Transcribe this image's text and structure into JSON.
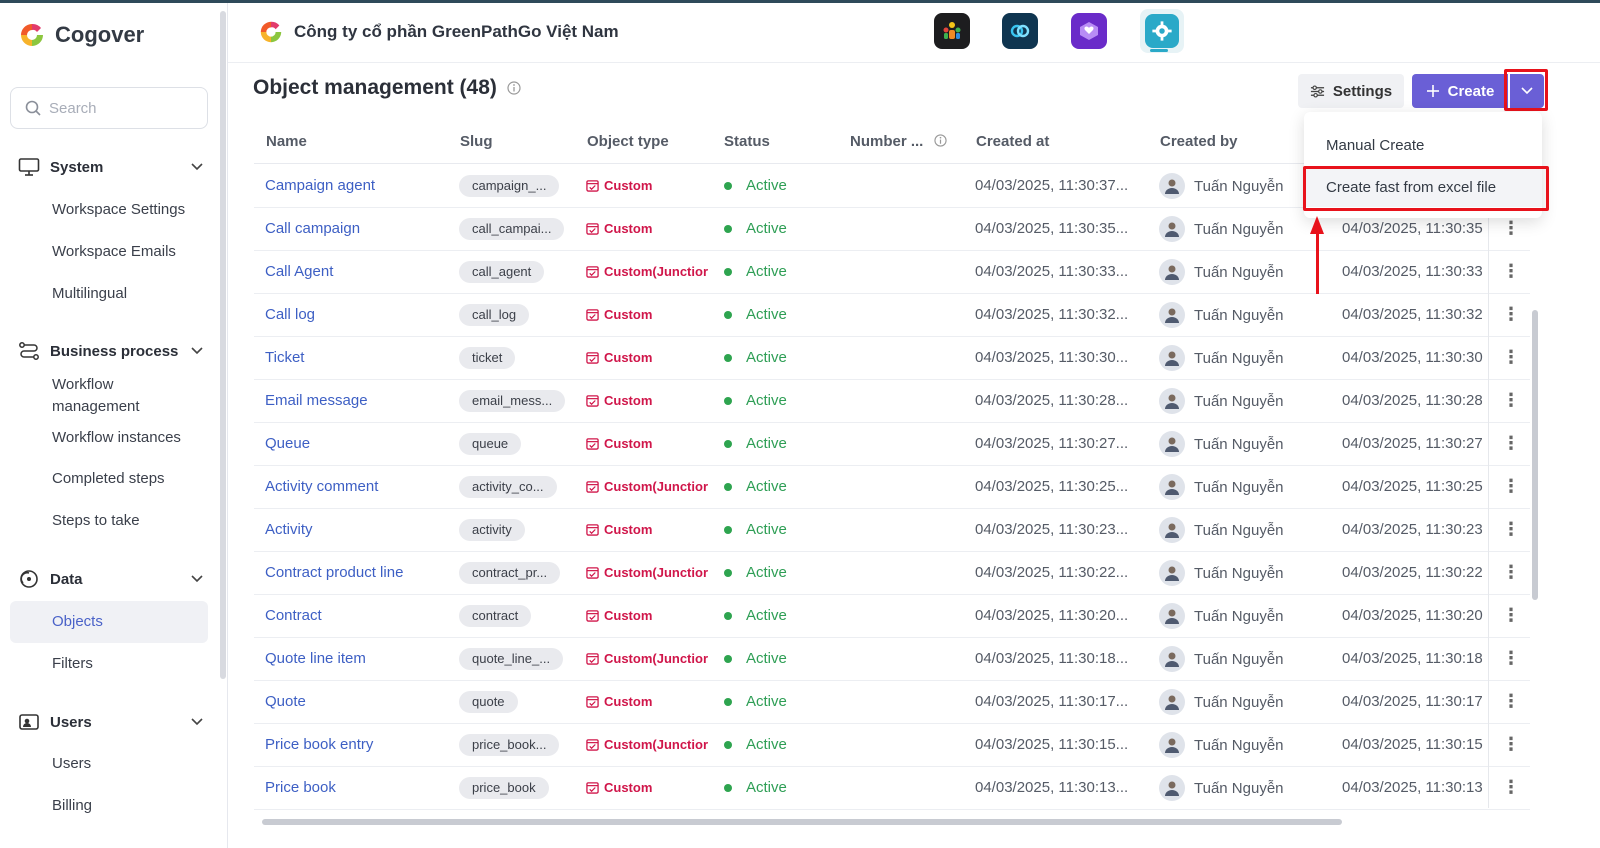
{
  "brand": {
    "name": "Cogover"
  },
  "search": {
    "placeholder": "Search"
  },
  "sidebar": {
    "groups": [
      {
        "label": "System",
        "items": [
          "Workspace Settings",
          "Workspace Emails",
          "Multilingual"
        ]
      },
      {
        "label": "Business process",
        "items": [
          "Workflow management",
          "Workflow instances",
          "Completed steps",
          "Steps to take"
        ]
      },
      {
        "label": "Data",
        "items": [
          "Objects",
          "Filters"
        ]
      },
      {
        "label": "Users",
        "items": [
          "Users",
          "Billing"
        ]
      }
    ],
    "active_item": "Objects"
  },
  "header": {
    "company": "Công ty cổ phần GreenPathGo Việt Nam",
    "apps": [
      "people-app-icon",
      "link-app-icon",
      "heart-box-app-icon",
      "gear-app-icon"
    ]
  },
  "page": {
    "title": "Object management (48)",
    "settings_label": "Settings",
    "create_label": "Create"
  },
  "menu": {
    "items": [
      "Manual Create",
      "Create fast from excel file"
    ]
  },
  "table": {
    "headers": [
      "Name",
      "Slug",
      "Object type",
      "Status",
      "Number ...",
      "Created at",
      "Created by"
    ],
    "rows": [
      {
        "name": "Campaign agent",
        "slug": "campaign_...",
        "type": "Custom",
        "status": "Active",
        "created": "04/03/2025, 11:30:37...",
        "by": "Tuấn Nguyễn",
        "updated": ""
      },
      {
        "name": "Call campaign",
        "slug": "call_campai...",
        "type": "Custom",
        "status": "Active",
        "created": "04/03/2025, 11:30:35...",
        "by": "Tuấn Nguyễn",
        "updated": "04/03/2025, 11:30:35"
      },
      {
        "name": "Call Agent",
        "slug": "call_agent",
        "type": "Custom(Junctior",
        "status": "Active",
        "created": "04/03/2025, 11:30:33...",
        "by": "Tuấn Nguyễn",
        "updated": "04/03/2025, 11:30:33"
      },
      {
        "name": "Call log",
        "slug": "call_log",
        "type": "Custom",
        "status": "Active",
        "created": "04/03/2025, 11:30:32...",
        "by": "Tuấn Nguyễn",
        "updated": "04/03/2025, 11:30:32"
      },
      {
        "name": "Ticket",
        "slug": "ticket",
        "type": "Custom",
        "status": "Active",
        "created": "04/03/2025, 11:30:30...",
        "by": "Tuấn Nguyễn",
        "updated": "04/03/2025, 11:30:30"
      },
      {
        "name": "Email message",
        "slug": "email_mess...",
        "type": "Custom",
        "status": "Active",
        "created": "04/03/2025, 11:30:28...",
        "by": "Tuấn Nguyễn",
        "updated": "04/03/2025, 11:30:28"
      },
      {
        "name": "Queue",
        "slug": "queue",
        "type": "Custom",
        "status": "Active",
        "created": "04/03/2025, 11:30:27...",
        "by": "Tuấn Nguyễn",
        "updated": "04/03/2025, 11:30:27"
      },
      {
        "name": "Activity comment",
        "slug": "activity_co...",
        "type": "Custom(Junctior",
        "status": "Active",
        "created": "04/03/2025, 11:30:25...",
        "by": "Tuấn Nguyễn",
        "updated": "04/03/2025, 11:30:25"
      },
      {
        "name": "Activity",
        "slug": "activity",
        "type": "Custom",
        "status": "Active",
        "created": "04/03/2025, 11:30:23...",
        "by": "Tuấn Nguyễn",
        "updated": "04/03/2025, 11:30:23"
      },
      {
        "name": "Contract product line",
        "slug": "contract_pr...",
        "type": "Custom(Junctior",
        "status": "Active",
        "created": "04/03/2025, 11:30:22...",
        "by": "Tuấn Nguyễn",
        "updated": "04/03/2025, 11:30:22"
      },
      {
        "name": "Contract",
        "slug": "contract",
        "type": "Custom",
        "status": "Active",
        "created": "04/03/2025, 11:30:20...",
        "by": "Tuấn Nguyễn",
        "updated": "04/03/2025, 11:30:20"
      },
      {
        "name": "Quote line item",
        "slug": "quote_line_...",
        "type": "Custom(Junctior",
        "status": "Active",
        "created": "04/03/2025, 11:30:18...",
        "by": "Tuấn Nguyễn",
        "updated": "04/03/2025, 11:30:18"
      },
      {
        "name": "Quote",
        "slug": "quote",
        "type": "Custom",
        "status": "Active",
        "created": "04/03/2025, 11:30:17...",
        "by": "Tuấn Nguyễn",
        "updated": "04/03/2025, 11:30:17"
      },
      {
        "name": "Price book entry",
        "slug": "price_book...",
        "type": "Custom(Junctior",
        "status": "Active",
        "created": "04/03/2025, 11:30:15...",
        "by": "Tuấn Nguyễn",
        "updated": "04/03/2025, 11:30:15"
      },
      {
        "name": "Price book",
        "slug": "price_book",
        "type": "Custom",
        "status": "Active",
        "created": "04/03/2025, 11:30:13...",
        "by": "Tuấn Nguyễn",
        "updated": "04/03/2025, 11:30:13"
      }
    ]
  },
  "colors": {
    "accent": "#6a5fd6",
    "link": "#3d5fc4",
    "custom_type": "#d0164a",
    "active": "#2ea44f",
    "annotation": "#e8121b"
  }
}
